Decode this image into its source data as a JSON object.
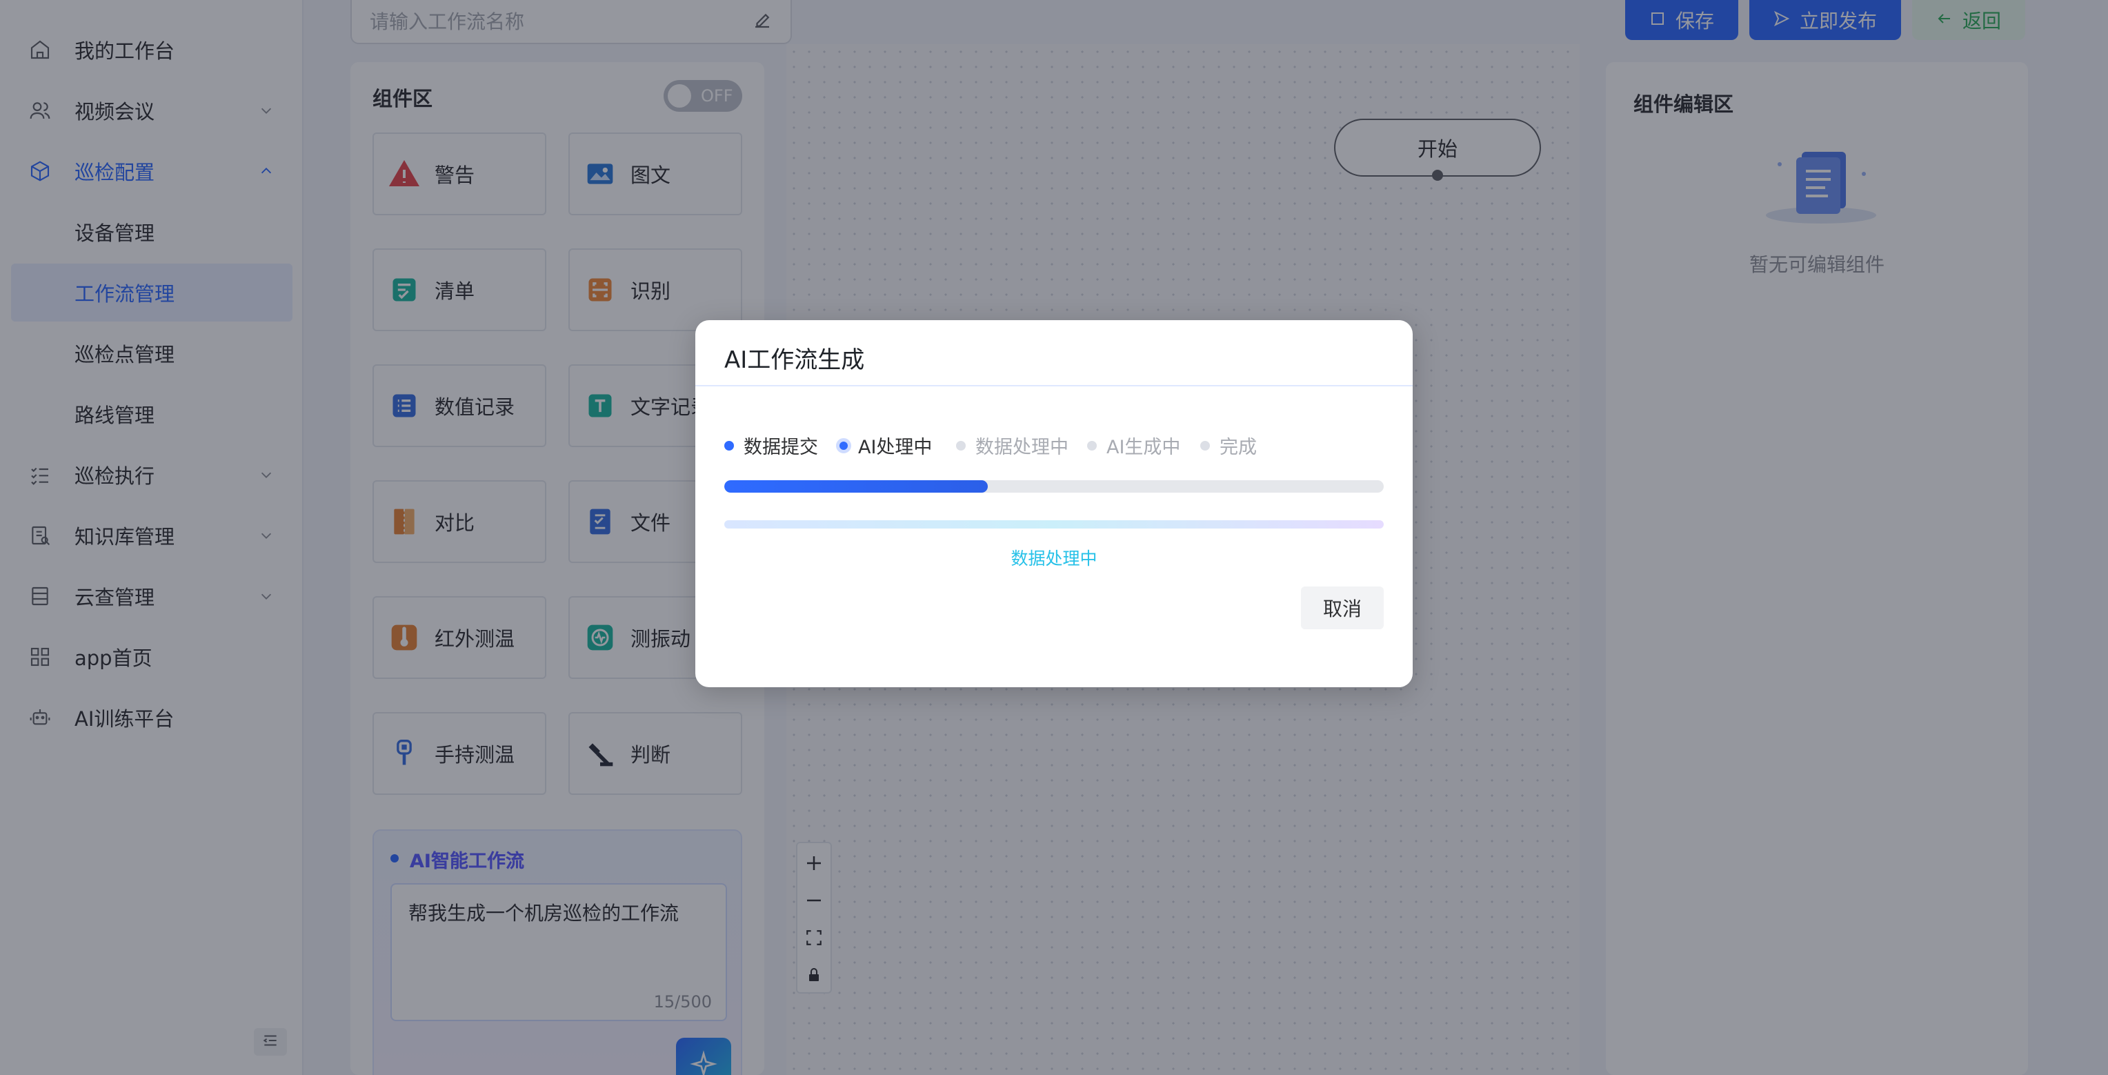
{
  "workflow_name": {
    "placeholder": "请输入工作流名称"
  },
  "sidebar": {
    "items": [
      {
        "label": "我的工作台",
        "icon": "home-icon"
      },
      {
        "label": "视频会议",
        "icon": "users-icon"
      },
      {
        "label": "巡检配置",
        "icon": "cube-icon"
      },
      {
        "label": "设备管理"
      },
      {
        "label": "工作流管理"
      },
      {
        "label": "巡检点管理"
      },
      {
        "label": "路线管理"
      },
      {
        "label": "巡检执行",
        "icon": "checklist-icon"
      },
      {
        "label": "知识库管理",
        "icon": "book-icon"
      },
      {
        "label": "云查管理",
        "icon": "database-icon"
      },
      {
        "label": "app首页",
        "icon": "grid-icon"
      },
      {
        "label": "AI训练平台",
        "icon": "robot-icon"
      }
    ]
  },
  "components": {
    "title": "组件区",
    "toggle_label": "OFF",
    "items": [
      {
        "label": "警告",
        "icon": "warning-icon"
      },
      {
        "label": "图文",
        "icon": "image-icon"
      },
      {
        "label": "清单",
        "icon": "checklist-icon"
      },
      {
        "label": "识别",
        "icon": "scan-icon"
      },
      {
        "label": "数值记录",
        "icon": "list-icon"
      },
      {
        "label": "文字记录",
        "icon": "text-icon"
      },
      {
        "label": "对比",
        "icon": "compare-icon"
      },
      {
        "label": "文件",
        "icon": "file-icon"
      },
      {
        "label": "红外测温",
        "icon": "thermometer-icon"
      },
      {
        "label": "测振动",
        "icon": "vibration-icon"
      },
      {
        "label": "手持测温",
        "icon": "handheld-thermometer-icon"
      },
      {
        "label": "判断",
        "icon": "gavel-icon"
      }
    ]
  },
  "ai_workflow": {
    "title": "AI智能工作流",
    "prompt": "帮我生成一个机房巡检的工作流",
    "counter": "15/500"
  },
  "canvas": {
    "start_node": "开始"
  },
  "toolbar": {
    "save": "保存",
    "publish": "立即发布",
    "back": "返回"
  },
  "editor": {
    "title": "组件编辑区",
    "empty": "暂无可编辑组件"
  },
  "modal": {
    "title": "AI工作流生成",
    "steps": [
      {
        "label": "数据提交",
        "state": "done"
      },
      {
        "label": "AI处理中",
        "state": "current"
      },
      {
        "label": "数据处理中",
        "state": "pending"
      },
      {
        "label": "AI生成中",
        "state": "pending"
      },
      {
        "label": "完成",
        "state": "pending"
      }
    ],
    "progress_percent": 40,
    "status": "数据处理中",
    "cancel": "取消"
  },
  "colors": {
    "accent": "#2f6bff",
    "status_cyan": "#27c1e8",
    "back_green": "#2fae5a"
  }
}
